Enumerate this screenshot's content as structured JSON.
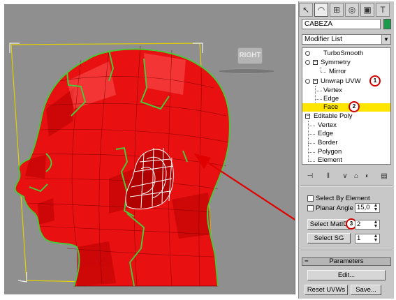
{
  "viewport": {
    "view_label": "RIGHT",
    "callout_color": "#e00000",
    "mesh_color": "#e81010",
    "seam_color": "#4cc63a",
    "bounds_color": "#e0d000"
  },
  "command_panel": {
    "tabs": [
      {
        "icon": "create-icon",
        "glyph": "↖"
      },
      {
        "icon": "modify-icon",
        "glyph": "◠"
      },
      {
        "icon": "hierarchy-icon",
        "glyph": "⊞"
      },
      {
        "icon": "motion-icon",
        "glyph": "◎"
      },
      {
        "icon": "display-icon",
        "glyph": "▣"
      },
      {
        "icon": "utilities-icon",
        "glyph": "T"
      }
    ],
    "object_name": "CABEZA",
    "object_color": "#1b9c4a",
    "modifier_list_label": "Modifier List",
    "stack": [
      {
        "label": "TurboSmooth"
      },
      {
        "label": "Symmetry"
      },
      {
        "label": "Mirror"
      },
      {
        "label": "Unwrap UVW"
      },
      {
        "label": "Vertex"
      },
      {
        "label": "Edge"
      },
      {
        "label": "Face"
      },
      {
        "label": "Editable Poly"
      },
      {
        "label": "Vertex"
      },
      {
        "label": "Edge"
      },
      {
        "label": "Border"
      },
      {
        "label": "Polygon"
      },
      {
        "label": "Element"
      }
    ],
    "selected_stack_item": "Face",
    "callouts": [
      "1",
      "2",
      "3"
    ],
    "selection": {
      "select_by_element_label": "Select By Element",
      "planar_angle_label": "Planar Angle",
      "planar_angle_value": "15,0",
      "select_matid_label": "Select MatID",
      "matid_value": "2",
      "select_sg_label": "Select SG",
      "sg_value": "1"
    },
    "parameters": {
      "title": "Parameters",
      "edit_label": "Edit...",
      "reset_label": "Reset UVWs",
      "save_label": "Save..."
    }
  }
}
